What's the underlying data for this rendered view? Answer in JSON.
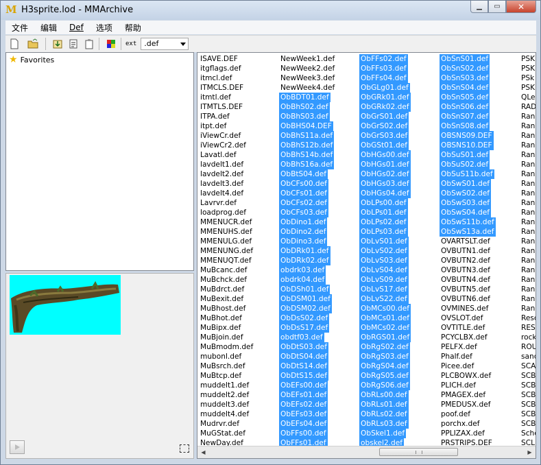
{
  "window": {
    "title": "H3sprite.lod - MMArchive",
    "app_icon": "M"
  },
  "menu": [
    "文件",
    "编辑",
    "Def",
    "选项",
    "帮助"
  ],
  "toolbar": {
    "ext_label": "ext",
    "ext_value": ".def"
  },
  "tree": {
    "favorites_label": "Favorites"
  },
  "file_columns": [
    {
      "items": [
        "ISAVE.DEF",
        "itgflags.def",
        "itmcl.def",
        "ITMCLS.DEF",
        "itmtl.def",
        "ITMTLS.DEF",
        "ITPA.def",
        "itpt.def",
        "iViewCr.def",
        "iViewCr2.def",
        "Lavatl.def",
        "lavdelt1.def",
        "lavdelt2.def",
        "lavdelt3.def",
        "lavdelt4.def",
        "Lavrvr.def",
        "loadprog.def",
        "MMENUCR.def",
        "MMENUHS.def",
        "MMENULG.def",
        "MMENUNG.def",
        "MMENUQT.def",
        "MuBcanc.def",
        "MuBchck.def",
        "MuBdrct.def",
        "MuBexit.def",
        "MuBhost.def",
        "MuBhot.def",
        "MuBipx.def",
        "MuBjoin.def",
        "MuBmodm.def",
        "mubonl.def",
        "MuBsrch.def",
        "MuBtcp.def",
        "muddelt1.def",
        "muddelt2.def",
        "muddelt3.def",
        "muddelt4.def",
        "Mudrvr.def",
        "MuGStat.def",
        "NewDay.def"
      ],
      "selected_from": 99
    },
    {
      "items": [
        "NewWeek1.def",
        "NewWeek2.def",
        "NewWeek3.def",
        "NewWeek4.def",
        "ObBDT01.def",
        "ObBhS02.def",
        "ObBhS03.def",
        "ObBHS04.DEF",
        "ObBhS11a.def",
        "ObBhS12b.def",
        "ObBhS14b.def",
        "ObBhS16a.def",
        "ObBtS04.def",
        "ObCFs00.def",
        "ObCFs01.def",
        "ObCFs02.def",
        "ObCFs03.def",
        "ObDino1.def",
        "ObDino2.def",
        "ObDino3.def",
        "ObDRk01.def",
        "ObDRk02.def",
        "obdrk03.def",
        "obdrk04.def",
        "ObDSh01.def",
        "ObDSM01.def",
        "ObDSM02.def",
        "ObDsS02.def",
        "ObDsS17.def",
        "obdtf03.def",
        "ObDtS03.def",
        "ObDtS04.def",
        "ObDtS14.def",
        "ObDtS15.def",
        "ObEFs00.def",
        "ObEFs01.def",
        "ObEFs02.def",
        "ObEFs03.def",
        "ObEFs04.def",
        "ObFFs00.def",
        "ObFFs01.def"
      ],
      "selected_from": 4
    },
    {
      "items": [
        "ObFFs02.def",
        "ObFFs03.def",
        "ObFFs04.def",
        "ObGLg01.def",
        "ObGRk01.def",
        "ObGRk02.def",
        "ObGrS01.def",
        "ObGrS02.def",
        "ObGrS03.def",
        "ObGSt01.def",
        "ObHGs00.def",
        "ObHGs01.def",
        "ObHGs02.def",
        "ObHGs03.def",
        "ObHGs04.def",
        "ObLPs00.def",
        "ObLPs01.def",
        "ObLPs02.def",
        "ObLPs03.def",
        "ObLvS01.def",
        "ObLvS02.def",
        "ObLvS03.def",
        "ObLvS04.def",
        "ObLvS09.def",
        "ObLvS17.def",
        "ObLvS22.def",
        "ObMCs00.def",
        "ObMCs01.def",
        "ObMCs02.def",
        "ObRGS01.def",
        "ObRgS02.def",
        "ObRgS03.def",
        "ObRgS04.def",
        "ObRgS05.def",
        "ObRgS06.def",
        "ObRLs00.def",
        "ObRLs01.def",
        "ObRLs02.def",
        "ObRLs03.def",
        "ObSkel1.def",
        "obskel2.def"
      ],
      "selected_from": 0
    },
    {
      "items": [
        "ObSnS01.def",
        "ObSnS02.def",
        "ObSnS03.def",
        "ObSnS04.def",
        "ObSnS05.def",
        "ObSnS06.def",
        "ObSnS07.def",
        "ObSnS08.def",
        "OBSNS09.DEF",
        "OBSNS10.DEF",
        "ObSuS01.def",
        "ObSuS02.def",
        "ObSuS11b.def",
        "ObSwS01.def",
        "ObSwS02.def",
        "ObSwS03.def",
        "ObSwS04.def",
        "ObSwS11b.def",
        "ObSwS13a.def",
        "OVARTSLT.def",
        "OVBUTN1.def",
        "OVBUTN2.def",
        "OVBUTN3.def",
        "OVBUTN4.def",
        "OVBUTN5.def",
        "OVBUTN6.def",
        "OVMINES.def",
        "OVSLOT.def",
        "OVTITLE.def",
        "PCYCLBX.def",
        "PELFX.def",
        "Phalf.def",
        "Picee.def",
        "PLCBOWX.def",
        "PLICH.def",
        "PMAGEX.def",
        "PMEDUSX.def",
        "poof.def",
        "porchx.def",
        "PPLIZAX.def",
        "PRSTRIPS.DEF"
      ],
      "selected_to": 18
    },
    {
      "items": [
        "PSK",
        "PSK",
        "PSk",
        "PSK",
        "QLe",
        "RAD",
        "Ran",
        "Ran",
        "Ran",
        "Ran",
        "Ran",
        "Ran",
        "Ran",
        "Ran",
        "Ran",
        "Ran",
        "Ran",
        "Ran",
        "Ran",
        "Ran",
        "Ran",
        "Ran",
        "Ran",
        "Ran",
        "Ran",
        "Ran",
        "Ran",
        "Resc",
        "RES",
        "rock",
        "ROU",
        "sanc",
        "SCA",
        "SCB",
        "SCB",
        "SCB",
        "SCB",
        "SCB",
        "SCB",
        "Schc",
        "SCL"
      ]
    }
  ]
}
